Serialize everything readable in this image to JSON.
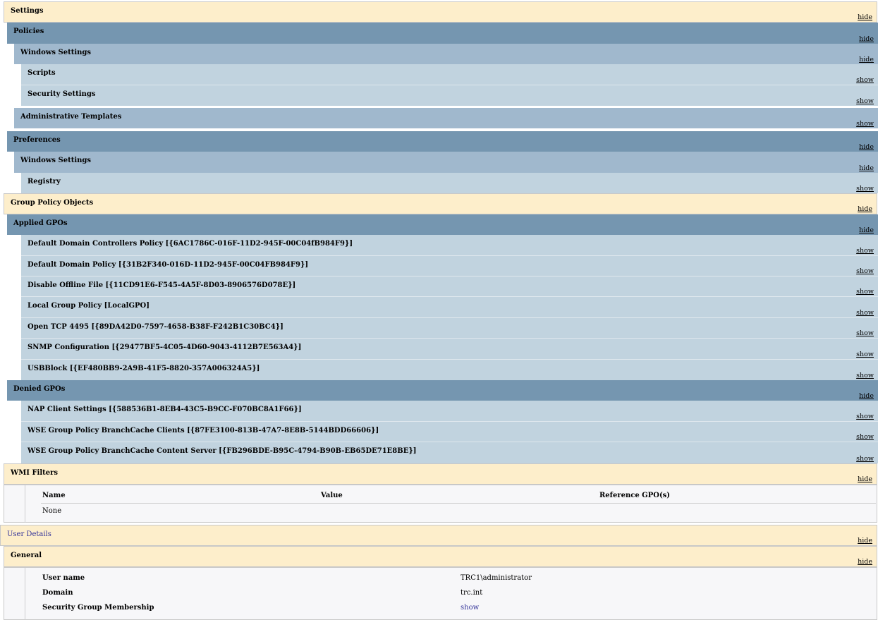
{
  "tree": {
    "settings": {
      "label": "Settings",
      "toggle": "hide"
    },
    "policies": {
      "label": "Policies",
      "toggle": "hide"
    },
    "policies_win": {
      "label": "Windows Settings",
      "toggle": "hide"
    },
    "scripts": {
      "label": "Scripts",
      "toggle": "show"
    },
    "security": {
      "label": "Security Settings",
      "toggle": "show"
    },
    "admin_templates": {
      "label": "Administrative Templates",
      "toggle": "show"
    },
    "preferences": {
      "label": "Preferences",
      "toggle": "hide"
    },
    "prefs_win": {
      "label": "Windows Settings",
      "toggle": "hide"
    },
    "registry": {
      "label": "Registry",
      "toggle": "show"
    },
    "gpo_objects": {
      "label": "Group Policy Objects",
      "toggle": "hide"
    },
    "applied": {
      "label": "Applied GPOs",
      "toggle": "hide"
    },
    "denied": {
      "label": "Denied GPOs",
      "toggle": "hide"
    },
    "wmi": {
      "label": "WMI Filters",
      "toggle": "hide"
    },
    "user_details": {
      "label": "User Details",
      "toggle": "hide"
    },
    "general": {
      "label": "General",
      "toggle": "hide"
    }
  },
  "applied_gpos": [
    {
      "label": "Default Domain Controllers Policy [{6AC1786C-016F-11D2-945F-00C04fB984F9}]",
      "toggle": "show"
    },
    {
      "label": "Default Domain Policy [{31B2F340-016D-11D2-945F-00C04FB984F9}]",
      "toggle": "show"
    },
    {
      "label": "Disable Offline File [{11CD91E6-F545-4A5F-8D03-8906576D078E}]",
      "toggle": "show"
    },
    {
      "label": "Local Group Policy [LocalGPO]",
      "toggle": "show"
    },
    {
      "label": "Open TCP 4495 [{89DA42D0-7597-4658-B38F-F242B1C30BC4}]",
      "toggle": "show"
    },
    {
      "label": "SNMP Configuration [{29477BF5-4C05-4D60-9043-4112B7E563A4}]",
      "toggle": "show"
    },
    {
      "label": "USBBlock [{EF480BB9-2A9B-41F5-8820-357A006324A5}]",
      "toggle": "show"
    }
  ],
  "denied_gpos": [
    {
      "label": "NAP Client Settings [{588536B1-8EB4-43C5-B9CC-F070BC8A1F66}]",
      "toggle": "show"
    },
    {
      "label": "WSE Group Policy BranchCache Clients [{87FE3100-813B-47A7-8E8B-5144BDD66606}]",
      "toggle": "show"
    },
    {
      "label": "WSE Group Policy BranchCache Content Server [{FB296BDE-B95C-4794-B90B-EB65DE71E8BE}]",
      "toggle": "show"
    }
  ],
  "wmi_table": {
    "col_name": "Name",
    "col_value": "Value",
    "col_ref": "Reference GPO(s)",
    "none": "None"
  },
  "general_table": {
    "user_name_label": "User name",
    "user_name_value": "TRC1\\administrator",
    "domain_label": "Domain",
    "domain_value": "trc.int",
    "sgm_label": "Security Group Membership",
    "sgm_value": "show"
  }
}
